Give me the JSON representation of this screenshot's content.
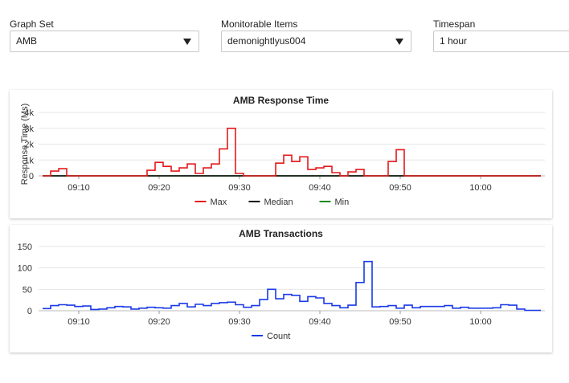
{
  "controls": {
    "graph_set": {
      "label": "Graph Set",
      "value": "AMB"
    },
    "monitorable_items": {
      "label": "Monitorable Items",
      "value": "demonightlyus004"
    },
    "timespan": {
      "label": "Timespan",
      "value": "1 hour"
    }
  },
  "chart_data": [
    {
      "type": "line",
      "title": "AMB Response Time",
      "ylabel": "Response Time (Ms)",
      "xlabel": "",
      "x_tick_labels": [
        "09:10",
        "09:20",
        "09:30",
        "09:40",
        "09:50",
        "10:00"
      ],
      "y_tick_labels": [
        "0",
        "1k",
        "2k",
        "3k",
        "4k"
      ],
      "ylim": [
        0,
        4000
      ],
      "x_minutes": [
        6,
        7,
        8,
        9,
        10,
        11,
        12,
        13,
        14,
        15,
        16,
        17,
        18,
        19,
        20,
        21,
        22,
        23,
        24,
        25,
        26,
        27,
        28,
        29,
        30,
        31,
        32,
        33,
        34,
        35,
        36,
        37,
        38,
        39,
        40,
        41,
        42,
        43,
        44,
        45,
        46,
        47,
        48,
        49,
        50,
        51,
        52,
        53,
        54,
        55,
        56,
        57,
        58,
        59,
        60,
        61,
        62,
        63,
        64,
        65,
        66,
        67
      ],
      "series": [
        {
          "name": "Max",
          "color": "#e31a1c",
          "values": [
            0,
            300,
            450,
            0,
            0,
            0,
            0,
            0,
            0,
            0,
            0,
            0,
            0,
            350,
            850,
            600,
            300,
            500,
            750,
            150,
            500,
            750,
            1700,
            3000,
            150,
            0,
            0,
            0,
            0,
            800,
            1300,
            900,
            1200,
            400,
            500,
            600,
            200,
            0,
            250,
            400,
            0,
            0,
            0,
            900,
            1650,
            0,
            0,
            0,
            0,
            0,
            0,
            0,
            0,
            0,
            0,
            0,
            0,
            0,
            0,
            0,
            0,
            0
          ]
        },
        {
          "name": "Median",
          "color": "#000000",
          "values": [
            0,
            0,
            0,
            0,
            0,
            0,
            0,
            0,
            0,
            0,
            0,
            0,
            0,
            0,
            0,
            0,
            0,
            0,
            0,
            0,
            0,
            0,
            0,
            0,
            0,
            0,
            0,
            0,
            0,
            0,
            0,
            0,
            0,
            0,
            0,
            0,
            0,
            0,
            0,
            0,
            0,
            0,
            0,
            0,
            0,
            0,
            0,
            0,
            0,
            0,
            0,
            0,
            0,
            0,
            0,
            0,
            0,
            0,
            0,
            0,
            0,
            0
          ]
        },
        {
          "name": "Min",
          "color": "#1f8a1f",
          "values": [
            0,
            0,
            0,
            0,
            0,
            0,
            0,
            0,
            0,
            0,
            0,
            0,
            0,
            0,
            0,
            0,
            0,
            0,
            0,
            0,
            0,
            0,
            0,
            0,
            0,
            0,
            0,
            0,
            0,
            0,
            0,
            0,
            0,
            0,
            0,
            0,
            0,
            0,
            0,
            0,
            0,
            0,
            0,
            0,
            0,
            0,
            0,
            0,
            0,
            0,
            0,
            0,
            0,
            0,
            0,
            0,
            0,
            0,
            0,
            0,
            0,
            0
          ]
        }
      ],
      "grid": true,
      "legend_position": "bottom"
    },
    {
      "type": "line",
      "title": "AMB Transactions",
      "ylabel": "",
      "xlabel": "",
      "x_tick_labels": [
        "09:10",
        "09:20",
        "09:30",
        "09:40",
        "09:50",
        "10:00"
      ],
      "y_tick_labels": [
        "0",
        "50",
        "100",
        "150"
      ],
      "ylim": [
        0,
        150
      ],
      "x_minutes": [
        6,
        7,
        8,
        9,
        10,
        11,
        12,
        13,
        14,
        15,
        16,
        17,
        18,
        19,
        20,
        21,
        22,
        23,
        24,
        25,
        26,
        27,
        28,
        29,
        30,
        31,
        32,
        33,
        34,
        35,
        36,
        37,
        38,
        39,
        40,
        41,
        42,
        43,
        44,
        45,
        46,
        47,
        48,
        49,
        50,
        51,
        52,
        53,
        54,
        55,
        56,
        57,
        58,
        59,
        60,
        61,
        62,
        63,
        64,
        65,
        66,
        67
      ],
      "series": [
        {
          "name": "Count",
          "color": "#1a3ae8",
          "values": [
            5,
            12,
            14,
            13,
            10,
            11,
            3,
            4,
            7,
            10,
            9,
            4,
            6,
            8,
            7,
            6,
            12,
            17,
            9,
            15,
            12,
            17,
            19,
            20,
            14,
            8,
            12,
            26,
            50,
            28,
            38,
            36,
            22,
            33,
            30,
            17,
            12,
            7,
            13,
            66,
            115,
            9,
            10,
            12,
            6,
            13,
            7,
            10,
            10,
            10,
            12,
            6,
            8,
            6,
            6,
            6,
            7,
            14,
            13,
            4,
            1,
            1
          ]
        }
      ],
      "grid": true,
      "legend_position": "bottom"
    }
  ]
}
